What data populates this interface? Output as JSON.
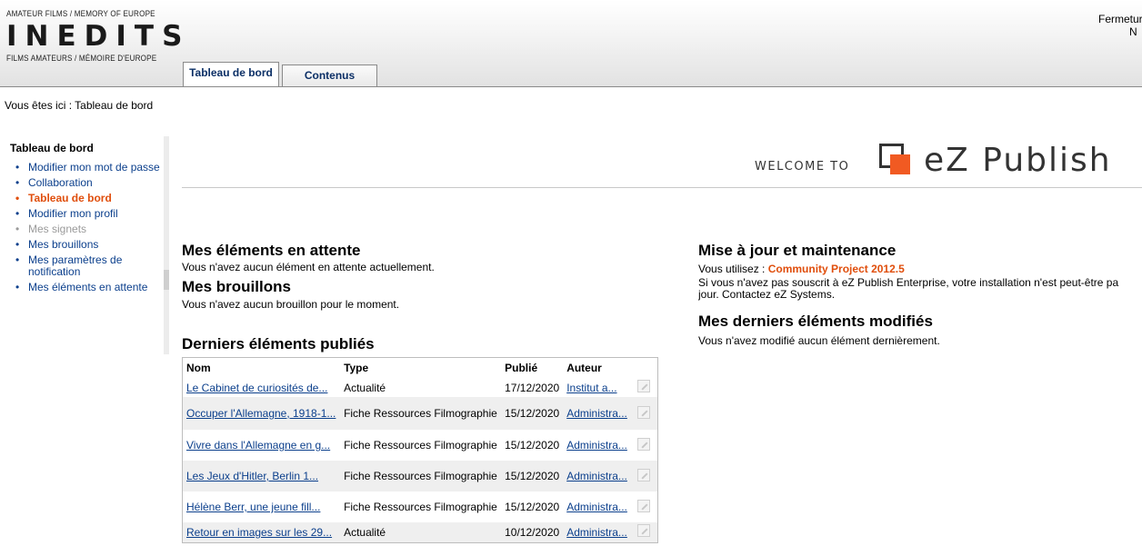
{
  "header": {
    "logo_top": "AMATEUR FILMS / MEMORY OF EUROPE",
    "logo_main": "INEDITS",
    "logo_bottom": "FILMS AMATEURS / MÉMOIRE D'EUROPE",
    "logout_line1": "Fermeture",
    "logout_line2": "N",
    "tabs": [
      {
        "label": "Tableau de bord",
        "active": true
      },
      {
        "label": "Contenus",
        "active": false
      }
    ]
  },
  "breadcrumb": "Vous êtes ici : Tableau de bord",
  "leftmenu": {
    "title": "Tableau de bord",
    "items": [
      {
        "label": "Modifier mon mot de passe",
        "state": "link"
      },
      {
        "label": "Collaboration",
        "state": "link"
      },
      {
        "label": "Tableau de bord",
        "state": "current"
      },
      {
        "label": "Modifier mon profil",
        "state": "link"
      },
      {
        "label": "Mes signets",
        "state": "disabled"
      },
      {
        "label": "Mes brouillons",
        "state": "link"
      },
      {
        "label": "Mes paramètres de notification",
        "state": "link"
      },
      {
        "label": "Mes éléments en attente",
        "state": "link"
      }
    ]
  },
  "welcome": {
    "prefix": "WELCOME TO",
    "brand": "eZ Publish"
  },
  "pending": {
    "title": "Mes éléments en attente",
    "text": "Vous n'avez aucun élément en attente actuellement."
  },
  "drafts": {
    "title": "Mes brouillons",
    "text": "Vous n'avez aucun brouillon pour le moment."
  },
  "published": {
    "title": "Derniers éléments publiés",
    "columns": [
      "Nom",
      "Type",
      "Publié",
      "Auteur"
    ],
    "rows": [
      {
        "name": "Le Cabinet de curiosités de...",
        "type": "Actualité",
        "date": "17/12/2020",
        "author": "Institut a..."
      },
      {
        "name": "Occuper l'Allemagne, 1918-1...",
        "type": "Fiche Ressources Filmographie",
        "date": "15/12/2020",
        "author": "Administra..."
      },
      {
        "name": "Vivre dans l'Allemagne en g...",
        "type": "Fiche Ressources Filmographie",
        "date": "15/12/2020",
        "author": "Administra..."
      },
      {
        "name": "Les Jeux d'Hitler, Berlin 1...",
        "type": "Fiche Ressources Filmographie",
        "date": "15/12/2020",
        "author": "Administra..."
      },
      {
        "name": "Hélène Berr, une jeune fill...",
        "type": "Fiche Ressources Filmographie",
        "date": "15/12/2020",
        "author": "Administra..."
      },
      {
        "name": "Retour en images sur les 29...",
        "type": "Actualité",
        "date": "10/12/2020",
        "author": "Administra..."
      }
    ]
  },
  "maintenance": {
    "title": "Mise à jour et maintenance",
    "using_prefix": "Vous utilisez : ",
    "version": "Community Project 2012.5",
    "notice": "Si vous n'avez pas souscrit à eZ Publish Enterprise, votre installation n'est peut-être pa jour. Contactez eZ Systems."
  },
  "modified": {
    "title": "Mes derniers éléments modifiés",
    "text": "Vous n'avez modifié aucun élément dernièrement."
  },
  "colors": {
    "accent": "#e04e0c",
    "link": "#0b3f8c",
    "ez_orange": "#f15a22"
  }
}
